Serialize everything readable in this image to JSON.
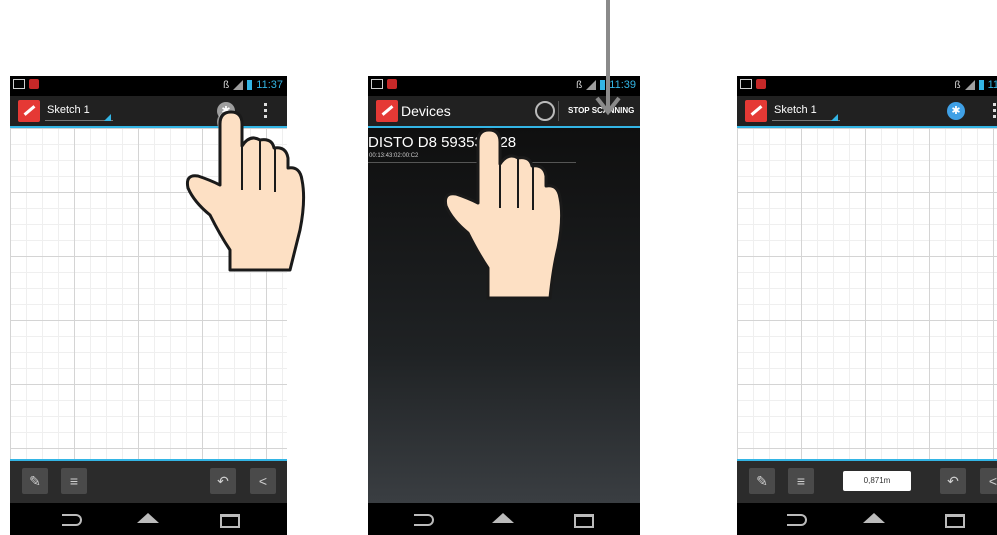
{
  "screens": [
    {
      "status": {
        "time": "11:37"
      },
      "actionbar": {
        "title": "Sketch 1",
        "bt_icon": "bluetooth-icon"
      },
      "toolbar": {
        "buttons": [
          "pen-icon",
          "list-icon",
          "undo-icon",
          "share-icon"
        ]
      }
    },
    {
      "status": {
        "time": "11:39"
      },
      "actionbar": {
        "title": "Devices",
        "stop_label": "STOP SCANNING"
      },
      "device": {
        "name": "DISTO D8 593530128",
        "address": "00:13:43:02:00:C2"
      }
    },
    {
      "status": {
        "time": "11"
      },
      "actionbar": {
        "title": "Sketch 1",
        "bt_icon": "bluetooth-icon"
      },
      "toolbar": {
        "measurement": "0,871m"
      }
    }
  ],
  "colors": {
    "accent": "#33b5e5",
    "brand": "#e53935",
    "bluetooth_active": "#3fa0e6"
  }
}
